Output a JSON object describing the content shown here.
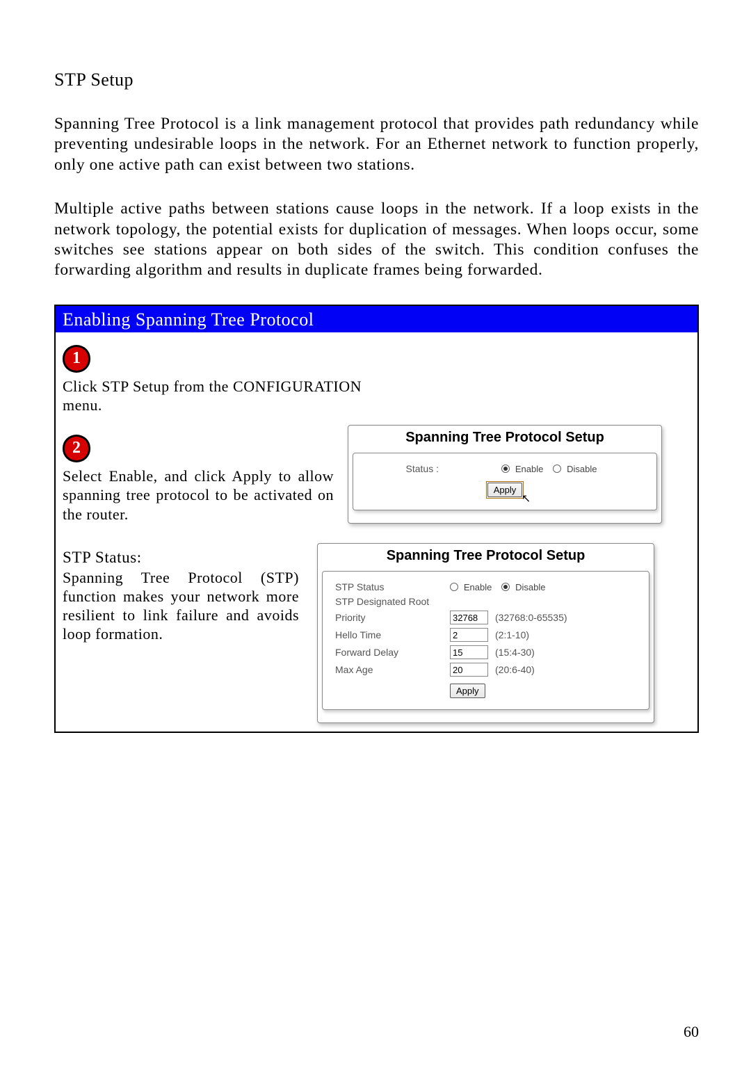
{
  "heading": "STP Setup",
  "para1": "Spanning Tree Protocol is a link management protocol that provides path redundancy while preventing undesirable loops in the network. For an Ethernet network to function properly, only one active path can exist between two stations.",
  "para2": "Multiple active paths between stations cause loops in the network. If a loop exists in the network topology, the potential exists for duplication of messages. When loops occur, some switches see stations appear on both sides of the switch. This condition confuses the forwarding algorithm and results in duplicate frames being forwarded.",
  "box_title": "Enabling Spanning Tree Protocol",
  "steps": {
    "num1": "1",
    "text1": "Click STP Setup from the CONFIGURATION menu.",
    "num2": "2",
    "text2": "Select Enable, and click Apply to allow spanning tree protocol to be activated on the router."
  },
  "panel1": {
    "title": "Spanning Tree Protocol Setup",
    "status_label": "Status :",
    "enable": "Enable",
    "disable": "Disable",
    "apply": "Apply"
  },
  "side": {
    "head": "STP Status:",
    "para": "Spanning Tree Protocol (STP) function makes your network more resilient to link failure and avoids loop formation."
  },
  "panel2": {
    "title": "Spanning Tree Protocol Setup",
    "rows": {
      "r0": {
        "label": "STP Status",
        "enable": "Enable",
        "disable": "Disable"
      },
      "r1": {
        "label": "STP Designated Root"
      },
      "r2": {
        "label": "Priority",
        "value": "32768",
        "hint": "(32768:0-65535)"
      },
      "r3": {
        "label": "Hello Time",
        "value": "2",
        "hint": "(2:1-10)"
      },
      "r4": {
        "label": "Forward Delay",
        "value": "15",
        "hint": "(15:4-30)"
      },
      "r5": {
        "label": "Max Age",
        "value": "20",
        "hint": "(20:6-40)"
      }
    },
    "apply": "Apply"
  },
  "page_number": "60"
}
